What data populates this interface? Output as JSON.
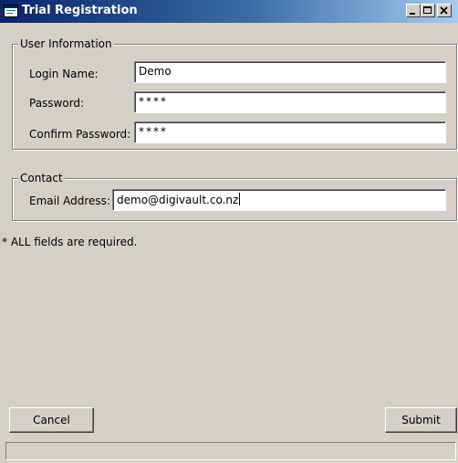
{
  "window": {
    "title": "Trial Registration",
    "icon": "app-window-icon",
    "controls": [
      "minimize-icon",
      "maximize-icon",
      "close-icon"
    ]
  },
  "user_information": {
    "legend": "User Information",
    "login_name_label": "Login Name:",
    "login_name_value": "Demo",
    "password_label": "Password:",
    "password_value": "****",
    "confirm_password_label": "Confirm Password:",
    "confirm_password_value": "****"
  },
  "contact": {
    "legend": "Contact",
    "email_label": "Email Address:",
    "email_value": "demo@digivault.co.nz"
  },
  "note": "* ALL fields are required.",
  "buttons": {
    "cancel": "Cancel",
    "submit": "Submit"
  },
  "colors": {
    "titlebar_start": "#0a246a",
    "titlebar_end": "#a6caf0",
    "window_bg": "#d4d0c8"
  }
}
